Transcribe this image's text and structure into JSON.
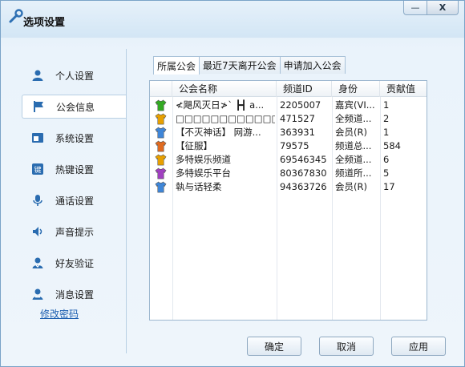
{
  "window": {
    "title": "选项设置",
    "min_glyph": "—",
    "close_glyph": "X"
  },
  "sidebar": {
    "items": [
      {
        "label": "个人设置",
        "icon": "person-icon"
      },
      {
        "label": "公会信息",
        "icon": "flag-icon",
        "active": true
      },
      {
        "label": "系统设置",
        "icon": "window-icon"
      },
      {
        "label": "热键设置",
        "icon": "key-icon"
      },
      {
        "label": "通话设置",
        "icon": "microphone-icon"
      },
      {
        "label": "声音提示",
        "icon": "speaker-icon"
      },
      {
        "label": "好友验证",
        "icon": "shield-person-icon"
      },
      {
        "label": "消息设置",
        "icon": "person-message-icon"
      }
    ],
    "change_password": "修改密码"
  },
  "tabs": [
    {
      "label": "所属公会",
      "active": true
    },
    {
      "label": "最近7天离开公会"
    },
    {
      "label": "申请加入公会"
    }
  ],
  "table": {
    "columns": [
      "公会名称",
      "频道ID",
      "身份",
      "贡献值"
    ],
    "rows": [
      {
        "name": "≮飓风灭日≯` ┣┫ a...",
        "id": "2205007",
        "role": "嘉宾(VI...",
        "points": "1",
        "shirt": "#33aa22"
      },
      {
        "name": "□□□□□□□□□□□□□...",
        "id": "471527",
        "role": "全频道...",
        "points": "2",
        "shirt": "#e8a000"
      },
      {
        "name": "【不灭神话】 网游...",
        "id": "363931",
        "role": "会员(R)",
        "points": "1",
        "shirt": "#3f86d8"
      },
      {
        "name": "【征服】",
        "id": "79575",
        "role": "频道总...",
        "points": "584",
        "shirt": "#e06a20"
      },
      {
        "name": "多特娱乐频道",
        "id": "69546345",
        "role": "全频道...",
        "points": "6",
        "shirt": "#e8a000"
      },
      {
        "name": "多特娱乐平台",
        "id": "80367830",
        "role": "频道所...",
        "points": "5",
        "shirt": "#a040c0"
      },
      {
        "name": "執与话轻柔",
        "id": "94363726",
        "role": "会员(R)",
        "points": "17",
        "shirt": "#3f86d8"
      }
    ]
  },
  "buttons": {
    "ok": "确定",
    "cancel": "取消",
    "apply": "应用"
  }
}
